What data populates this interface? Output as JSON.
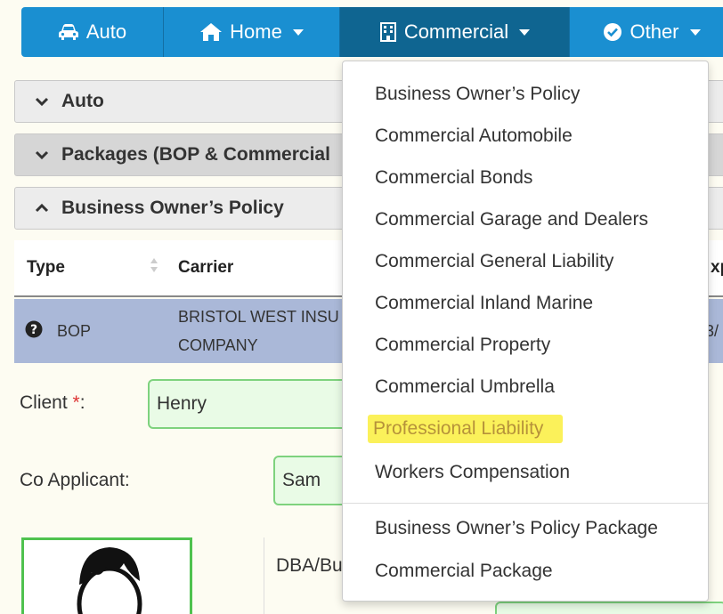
{
  "nav": {
    "tabs": [
      {
        "label": "Auto",
        "icon": "car-icon"
      },
      {
        "label": "Home",
        "icon": "home-icon"
      },
      {
        "label": "Commercial",
        "icon": "building-icon"
      },
      {
        "label": "Other",
        "icon": "check-circle-icon"
      }
    ],
    "colors": {
      "bar": "#1a8fd1",
      "active": "#0f6591"
    }
  },
  "accordions": {
    "auto": "Auto",
    "packages": "Packages (BOP & Commercial",
    "bop": "Business Owner’s Policy"
  },
  "table": {
    "headers": {
      "type": "Type",
      "carrier": "Carrier",
      "exp": "xp"
    },
    "row": {
      "type": "BOP",
      "carrier_line1": "BRISTOL WEST INSU",
      "carrier_line2": "COMPANY",
      "exp": "3/"
    }
  },
  "form": {
    "client_label": "Client ",
    "required_mark": "*",
    "client_colon": ":",
    "client_value": "Henry",
    "coapplicant_label": "Co Applicant:",
    "coapplicant_value": "Sam",
    "dba_label": "DBA/Bu"
  },
  "dropdown": {
    "items": [
      "Business Owner’s Policy",
      "Commercial Automobile",
      "Commercial Bonds",
      "Commercial Garage and Dealers",
      "Commercial General Liability",
      "Commercial Inland Marine",
      "Commercial Property",
      "Commercial Umbrella",
      "Professional Liability",
      "Workers Compensation"
    ],
    "package_items": [
      "Business Owner’s Policy Package",
      "Commercial Package"
    ],
    "highlight_color": "#fbf15a"
  }
}
